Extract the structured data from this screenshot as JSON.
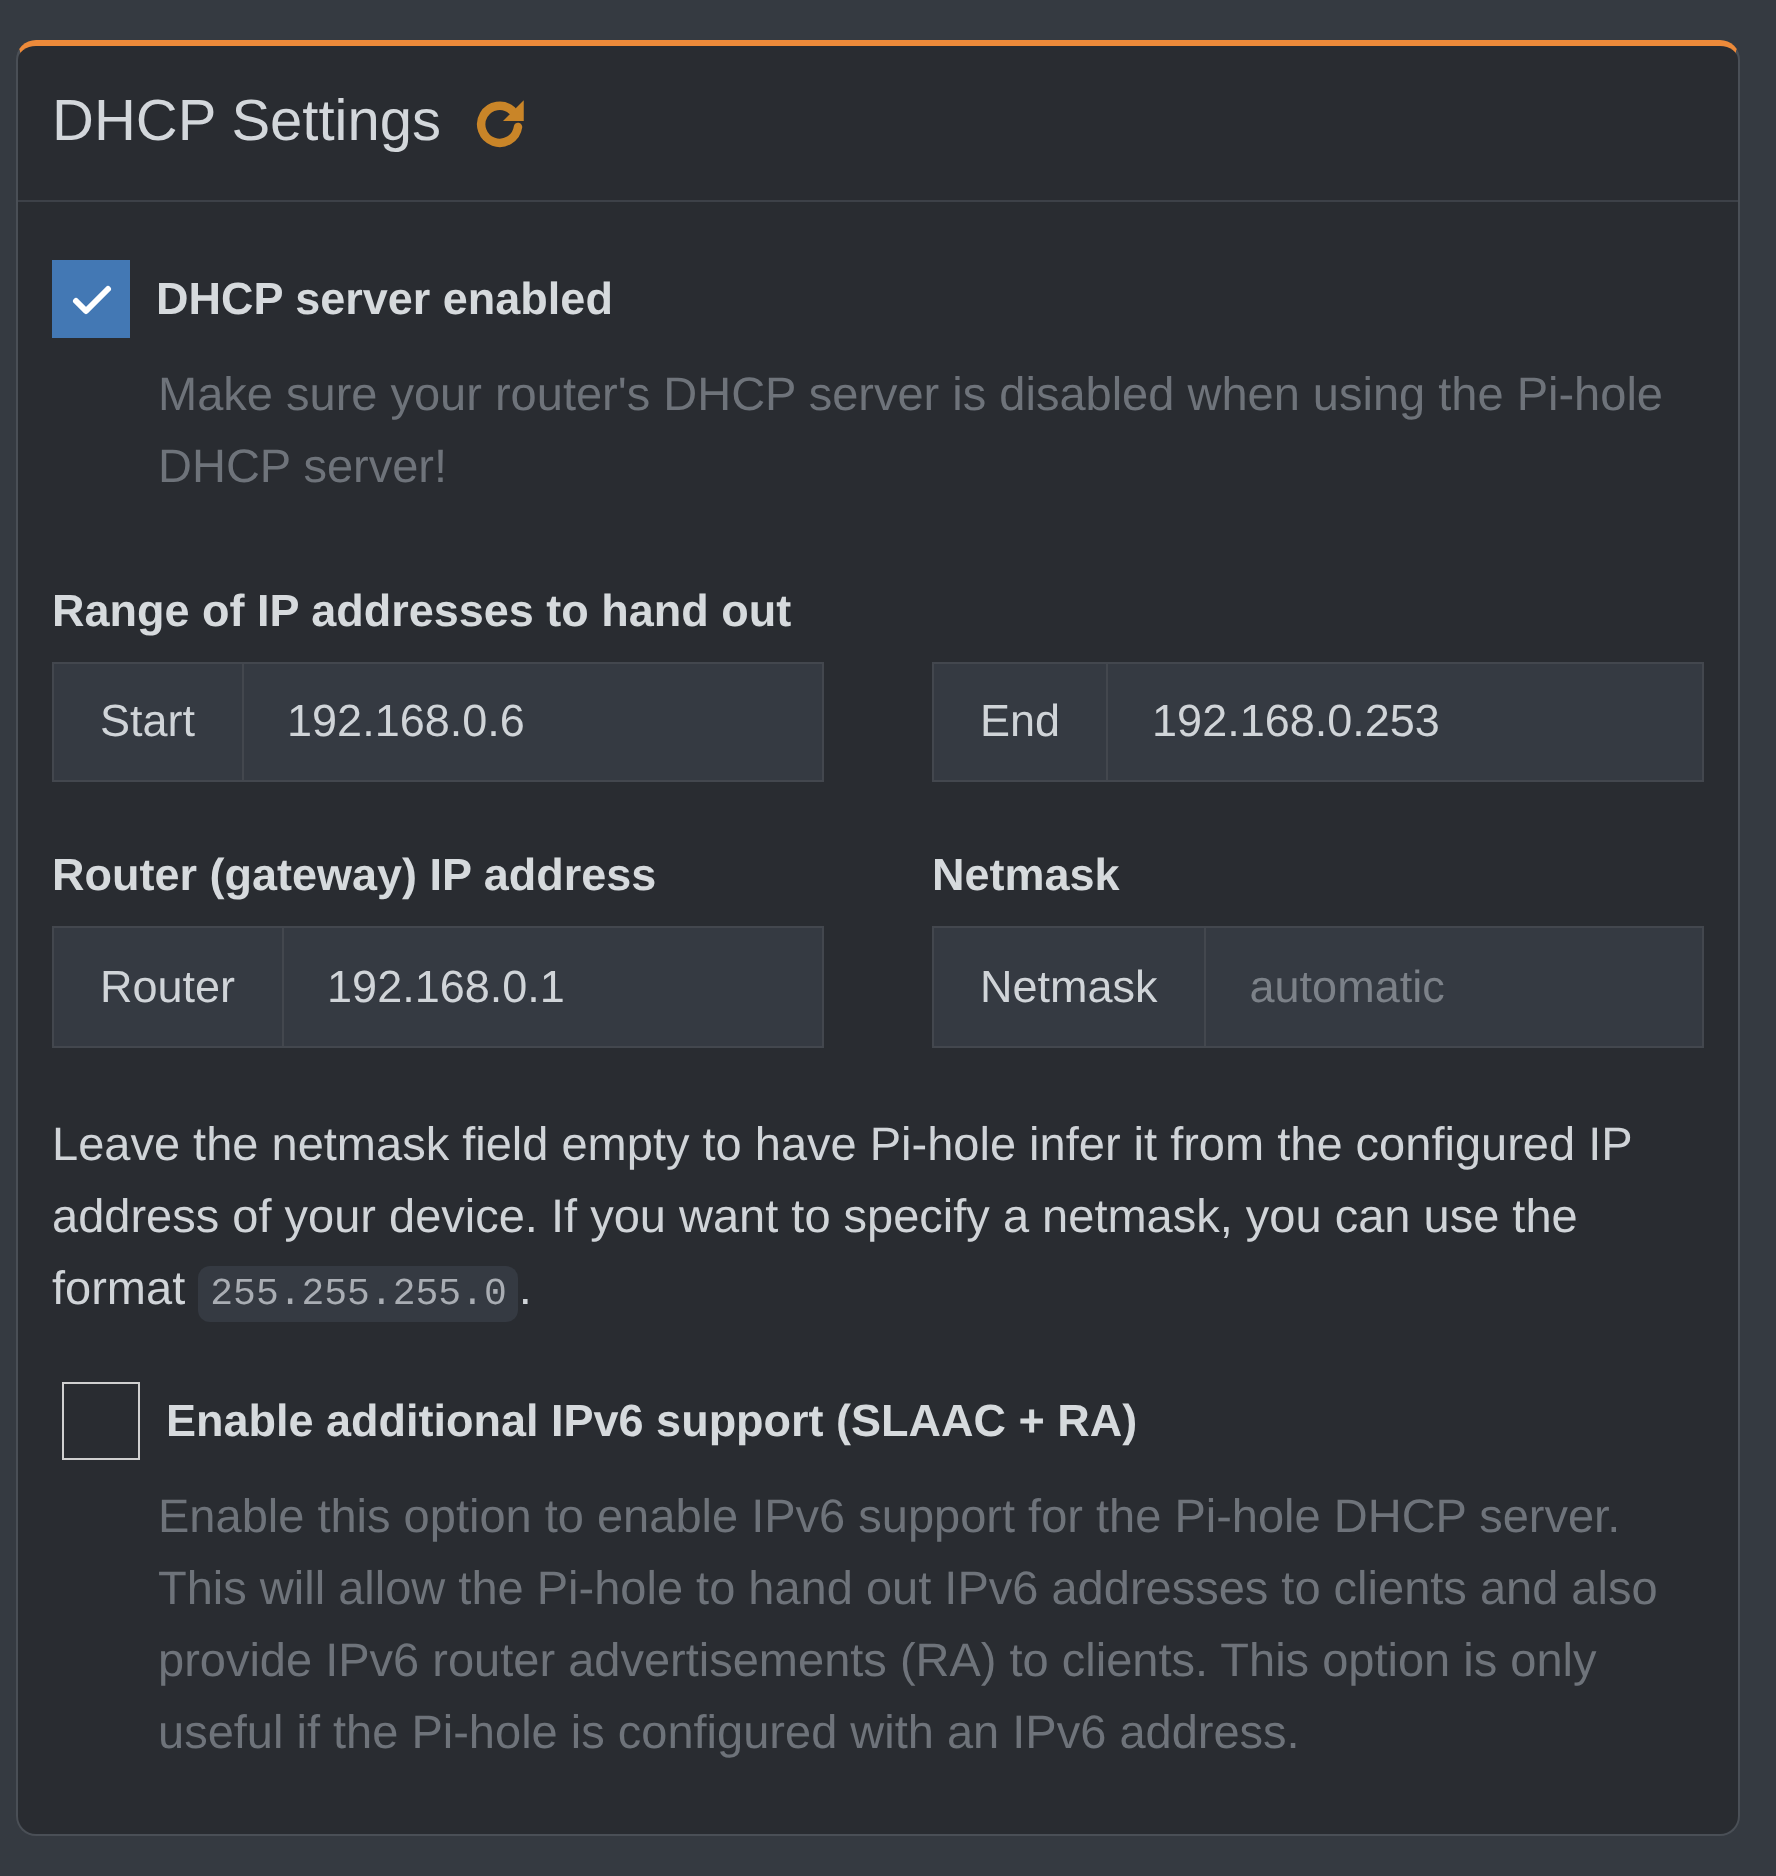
{
  "panel": {
    "title": "DHCP Settings"
  },
  "dhcp_server": {
    "label": "DHCP server enabled",
    "checked": true,
    "help": "Make sure your router's DHCP server is disabled when using the Pi-hole DHCP server!"
  },
  "field_rows": [
    {
      "heading": "Range of IP addresses to hand out",
      "fields": [
        {
          "addon": "Start",
          "value": "192.168.0.6"
        },
        {
          "addon": "End",
          "value": "192.168.0.253"
        }
      ]
    },
    {
      "fields": [
        {
          "heading": "Router (gateway) IP address",
          "addon": "Router",
          "value": "192.168.0.1"
        },
        {
          "heading": "Netmask",
          "addon": "Netmask",
          "placeholder": "automatic"
        }
      ]
    }
  ],
  "netmask_note": {
    "text": "Leave the netmask field empty to have Pi-hole infer it from the configured IP address of your device. If you want to specify a netmask, you can use the format",
    "code": "255.255.255.0",
    "end": "."
  },
  "ipv6_support": {
    "label": "Enable additional IPv6 support (SLAAC + RA)",
    "checked": false,
    "help": "Enable this option to enable IPv6 support for the Pi-hole DHCP server. This will allow the Pi-hole to hand out IPv6 addresses to clients and also provide IPv6 router advertisements (RA) to clients. This option is only useful if the Pi-hole is configured with an IPv6 address."
  }
}
